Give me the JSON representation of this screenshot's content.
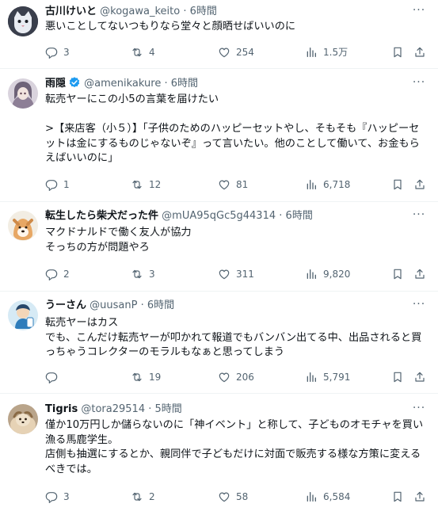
{
  "tweets": [
    {
      "name": "古川けいと",
      "handle": "@kogawa_keito",
      "dot": "·",
      "time": "6時間",
      "verified": false,
      "text": "悪いことしてないつもりなら堂々と顔晒せばいいのに",
      "stats": {
        "reply": "3",
        "retweet": "4",
        "like": "254",
        "views": "1.5万"
      }
    },
    {
      "name": "雨隠",
      "handle": "@amenikakure",
      "dot": "·",
      "time": "6時間",
      "verified": true,
      "text": "転売ヤーにこの小5の言葉を届けたい\n\n>【来店客（小５）】「子供のためのハッピーセットやし、そもそも『ハッピーセットは金にするものじゃないぞ』って言いたい。他のことして働いて、お金もらえばいいのに」",
      "stats": {
        "reply": "1",
        "retweet": "12",
        "like": "81",
        "views": "6,718"
      }
    },
    {
      "name": "転生したら柴犬だった件",
      "handle": "@mUA95qGc5g44314",
      "dot": "·",
      "time": "6時間",
      "verified": false,
      "text": "マクドナルドで働く友人が協力\nそっちの方が問題やろ",
      "stats": {
        "reply": "2",
        "retweet": "3",
        "like": "311",
        "views": "9,820"
      }
    },
    {
      "name": "うーさん",
      "handle": "@uusanP",
      "dot": "·",
      "time": "6時間",
      "verified": false,
      "text": "転売ヤーはカス\nでも、こんだけ転売ヤーが叩かれて報道でもバンバン出てる中、出品されると買っちゃうコレクターのモラルもなぁと思ってしまう",
      "stats": {
        "reply": "",
        "retweet": "19",
        "like": "206",
        "views": "5,791"
      }
    },
    {
      "name": "Tigris",
      "handle": "@tora29514",
      "dot": "·",
      "time": "5時間",
      "verified": false,
      "text": "僅か10万円しか儲らないのに「神イベント」と称して、子どものオモチャを買い漁る馬鹿学生。\n店側も抽選にするとか、親同伴で子どもだけに対面で販売する様な方策に変えるべきでは。",
      "stats": {
        "reply": "3",
        "retweet": "2",
        "like": "58",
        "views": "6,584"
      }
    }
  ],
  "more_glyph": "···",
  "colors": {
    "text": "#0f1419",
    "muted": "#536471",
    "verified": "#1d9bf0",
    "divider": "#eff3f4"
  }
}
